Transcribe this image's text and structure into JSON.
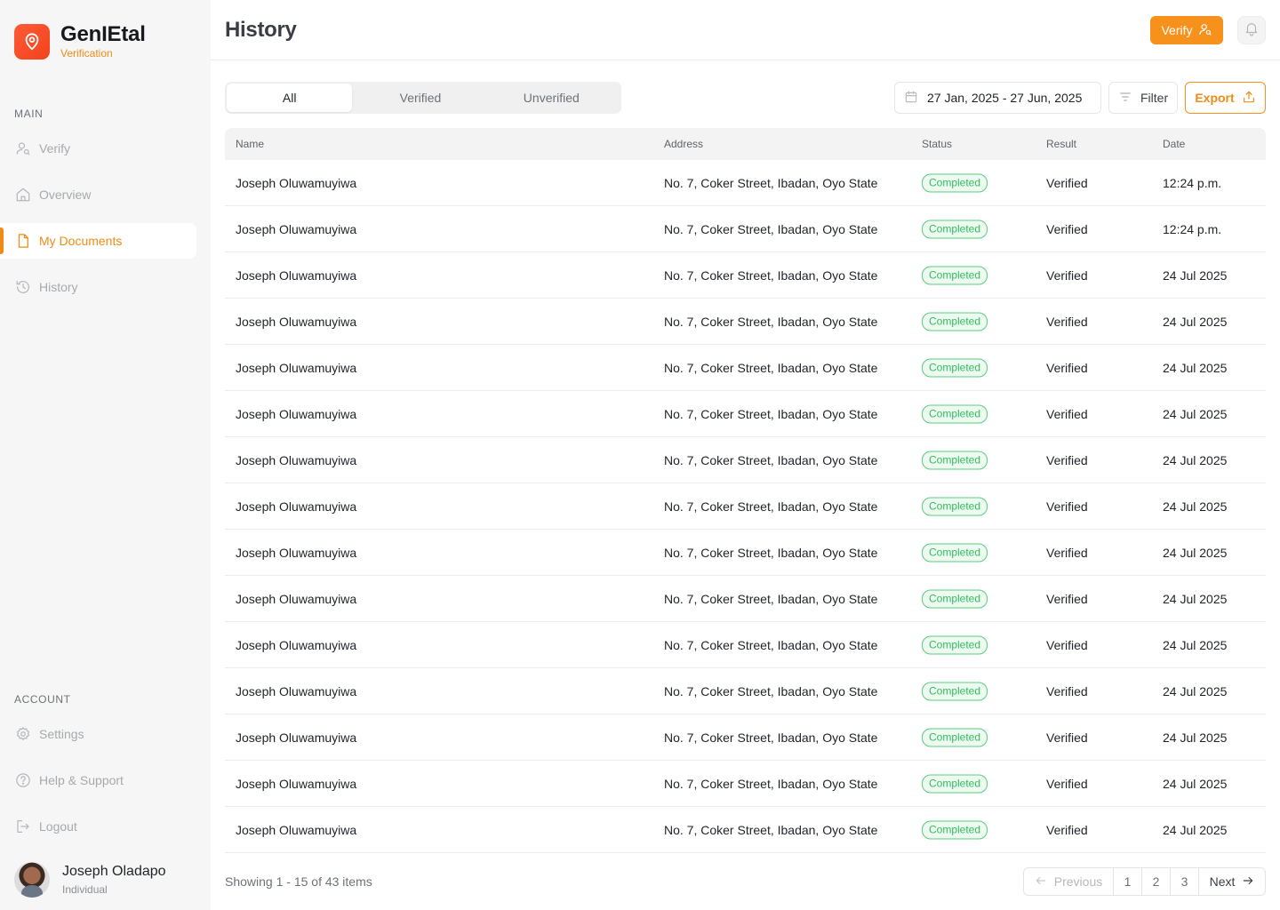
{
  "brand": {
    "name": "GenIEtal",
    "subtitle": "Verification",
    "accent": "#f08c16",
    "logo_color": "#f2431c"
  },
  "sidebar": {
    "main_label": "MAIN",
    "main_items": [
      {
        "label": "Verify",
        "icon": "user-search-icon"
      },
      {
        "label": "Overview",
        "icon": "home-icon"
      },
      {
        "label": "My Documents",
        "icon": "document-icon",
        "active": true
      },
      {
        "label": "History",
        "icon": "history-icon"
      }
    ],
    "account_label": "ACCOUNT",
    "account_items": [
      {
        "label": "Settings",
        "icon": "gear-icon"
      },
      {
        "label": "Help & Support",
        "icon": "help-icon"
      },
      {
        "label": "Logout",
        "icon": "logout-icon"
      }
    ]
  },
  "user": {
    "name": "Joseph Oladapo",
    "role": "Individual"
  },
  "header": {
    "title": "History",
    "verify_label": "Verify"
  },
  "toolbar": {
    "tabs": [
      {
        "label": "All",
        "active": true
      },
      {
        "label": "Verified"
      },
      {
        "label": "Unverified"
      }
    ],
    "date_range": "27 Jan, 2025 - 27 Jun, 2025",
    "filter_label": "Filter",
    "export_label": "Export"
  },
  "table": {
    "columns": [
      "Name",
      "Address",
      "Status",
      "Result",
      "Date"
    ],
    "rows": [
      {
        "name": "Joseph Oluwamuyiwa",
        "address": "No. 7, Coker Street, Ibadan, Oyo State",
        "status": "Completed",
        "result": "Verified",
        "date": "12:24 p.m."
      },
      {
        "name": "Joseph Oluwamuyiwa",
        "address": "No. 7, Coker Street, Ibadan, Oyo State",
        "status": "Completed",
        "result": "Verified",
        "date": "12:24 p.m."
      },
      {
        "name": "Joseph Oluwamuyiwa",
        "address": "No. 7, Coker Street, Ibadan, Oyo State",
        "status": "Completed",
        "result": "Verified",
        "date": "24 Jul 2025"
      },
      {
        "name": "Joseph Oluwamuyiwa",
        "address": "No. 7, Coker Street, Ibadan, Oyo State",
        "status": "Completed",
        "result": "Verified",
        "date": "24 Jul 2025"
      },
      {
        "name": "Joseph Oluwamuyiwa",
        "address": "No. 7, Coker Street, Ibadan, Oyo State",
        "status": "Completed",
        "result": "Verified",
        "date": "24 Jul 2025"
      },
      {
        "name": "Joseph Oluwamuyiwa",
        "address": "No. 7, Coker Street, Ibadan, Oyo State",
        "status": "Completed",
        "result": "Verified",
        "date": "24 Jul 2025"
      },
      {
        "name": "Joseph Oluwamuyiwa",
        "address": "No. 7, Coker Street, Ibadan, Oyo State",
        "status": "Completed",
        "result": "Verified",
        "date": "24 Jul 2025"
      },
      {
        "name": "Joseph Oluwamuyiwa",
        "address": "No. 7, Coker Street, Ibadan, Oyo State",
        "status": "Completed",
        "result": "Verified",
        "date": "24 Jul 2025"
      },
      {
        "name": "Joseph Oluwamuyiwa",
        "address": "No. 7, Coker Street, Ibadan, Oyo State",
        "status": "Completed",
        "result": "Verified",
        "date": "24 Jul 2025"
      },
      {
        "name": "Joseph Oluwamuyiwa",
        "address": "No. 7, Coker Street, Ibadan, Oyo State",
        "status": "Completed",
        "result": "Verified",
        "date": "24 Jul 2025"
      },
      {
        "name": "Joseph Oluwamuyiwa",
        "address": "No. 7, Coker Street, Ibadan, Oyo State",
        "status": "Completed",
        "result": "Verified",
        "date": "24 Jul 2025"
      },
      {
        "name": "Joseph Oluwamuyiwa",
        "address": "No. 7, Coker Street, Ibadan, Oyo State",
        "status": "Completed",
        "result": "Verified",
        "date": "24 Jul 2025"
      },
      {
        "name": "Joseph Oluwamuyiwa",
        "address": "No. 7, Coker Street, Ibadan, Oyo State",
        "status": "Completed",
        "result": "Verified",
        "date": "24 Jul 2025"
      },
      {
        "name": "Joseph Oluwamuyiwa",
        "address": "No. 7, Coker Street, Ibadan, Oyo State",
        "status": "Completed",
        "result": "Verified",
        "date": "24 Jul 2025"
      },
      {
        "name": "Joseph Oluwamuyiwa",
        "address": "No. 7, Coker Street, Ibadan, Oyo State",
        "status": "Completed",
        "result": "Verified",
        "date": "24 Jul 2025"
      }
    ]
  },
  "footer": {
    "showing": "Showing 1 - 15 of 43 items",
    "prev_label": "Previous",
    "pages": [
      "1",
      "2",
      "3"
    ],
    "next_label": "Next"
  }
}
